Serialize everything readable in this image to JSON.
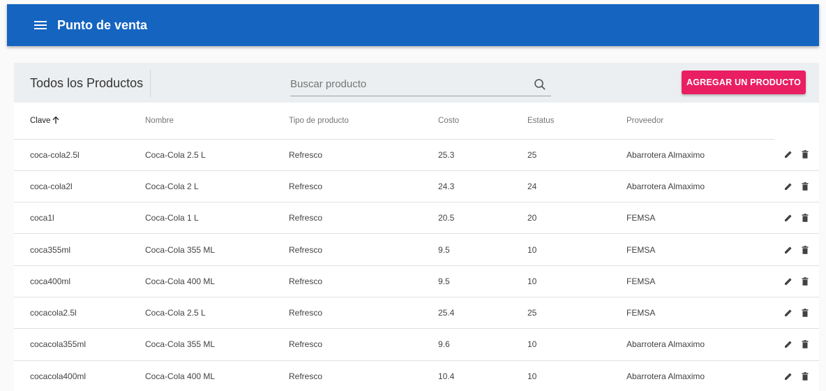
{
  "app": {
    "title": "Punto de venta"
  },
  "header": {
    "title": "Todos los Productos",
    "search_placeholder": "Buscar producto",
    "add_label": "AGREGAR UN PRODUCTO"
  },
  "table": {
    "columns": [
      "Clave",
      "Nombre",
      "Tipo de producto",
      "Costo",
      "Estatus",
      "Proveedor"
    ],
    "sort": {
      "column": "Clave",
      "direction": "asc"
    },
    "rows": [
      [
        "coca-cola2.5l",
        "Coca-Cola 2.5 L",
        "Refresco",
        "25.3",
        "25",
        "Abarrotera Almaximo"
      ],
      [
        "coca-cola2l",
        "Coca-Cola 2 L",
        "Refresco",
        "24.3",
        "24",
        "Abarrotera Almaximo"
      ],
      [
        "coca1l",
        "Coca-Cola 1 L",
        "Refresco",
        "20.5",
        "20",
        "FEMSA"
      ],
      [
        "coca355ml",
        "Coca-Cola 355 ML",
        "Refresco",
        "9.5",
        "10",
        "FEMSA"
      ],
      [
        "coca400ml",
        "Coca-Cola 400 ML",
        "Refresco",
        "9.5",
        "10",
        "FEMSA"
      ],
      [
        "cocacola2.5l",
        "Coca-Cola 2.5 L",
        "Refresco",
        "25.4",
        "25",
        "FEMSA"
      ],
      [
        "cocacola355ml",
        "Coca-Cola 355 ML",
        "Refresco",
        "9.6",
        "10",
        "Abarrotera Almaximo"
      ],
      [
        "cocacola400ml",
        "Coca-Cola 400 ML",
        "Refresco",
        "10.4",
        "10",
        "Abarrotera Almaximo"
      ]
    ],
    "row_actions": [
      "edit-icon",
      "delete-icon"
    ]
  },
  "colors": {
    "toolbar": "#1565c0",
    "accent": "#e91e63",
    "header_bg": "#eceff1"
  }
}
